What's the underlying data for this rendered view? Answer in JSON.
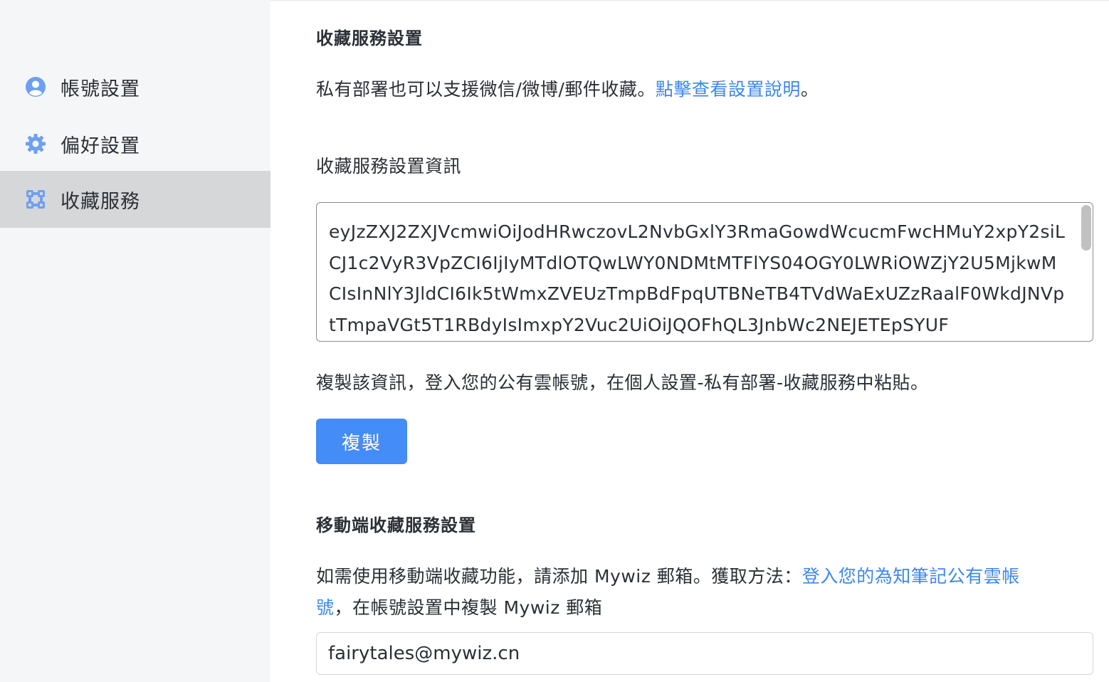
{
  "sidebar": {
    "items": [
      {
        "label": "帳號設置",
        "icon": "user-icon",
        "active": false
      },
      {
        "label": "偏好設置",
        "icon": "gear-icon",
        "active": false
      },
      {
        "label": "收藏服務",
        "icon": "collection-service-icon",
        "active": true
      }
    ]
  },
  "main": {
    "section_title": "收藏服務設置",
    "intro_text": "私有部署也可以支援微信/微博/郵件收藏。",
    "intro_link": "點擊查看設置說明",
    "intro_tail": "。",
    "info_label": "收藏服務設置資訊",
    "info_value": "eyJzZXJ2ZXJVcmwiOiJodHRwczovL2NvbGxlY3RmaGowdWcucmFwcHMuY2xpY2siLCJ1c2VyR3VpZCI6IjIyMTdlOTQwLWY0NDMtMTFlYS04OGY0LWRiOWZjY2U5MjkwMCIsInNlY3JldCI6Ik5tWmxZVEUzTmpBdFpqUTBNeTB4TVdWaExUZzRaalF0WkdJNVptTmpaVGt5T1RBdyIsImxpY2Vuc2UiOiJQOFhQL3JnbWc2NEJETEpSYUF",
    "copy_instruction": "複製該資訊，登入您的公有雲帳號，在個人設置-私有部署-收藏服務中粘貼。",
    "copy_button": "複製",
    "mobile_title": "移動端收藏服務設置",
    "mobile_text_1": "如需使用移動端收藏功能，請添加 Mywiz 郵箱。獲取方法：",
    "mobile_link_1": "登入您的為知筆記公有雲帳",
    "mobile_link_2": "號",
    "mobile_text_2": "，在帳號設置中複製 Mywiz 郵箱",
    "email_value": "fairytales@mywiz.cn"
  },
  "colors": {
    "accent": "#448cf7",
    "link": "#3c87f0",
    "icon": "#6ea0f2",
    "sidebar_bg": "#f5f6f7",
    "sidebar_active": "#d6d7d9"
  }
}
